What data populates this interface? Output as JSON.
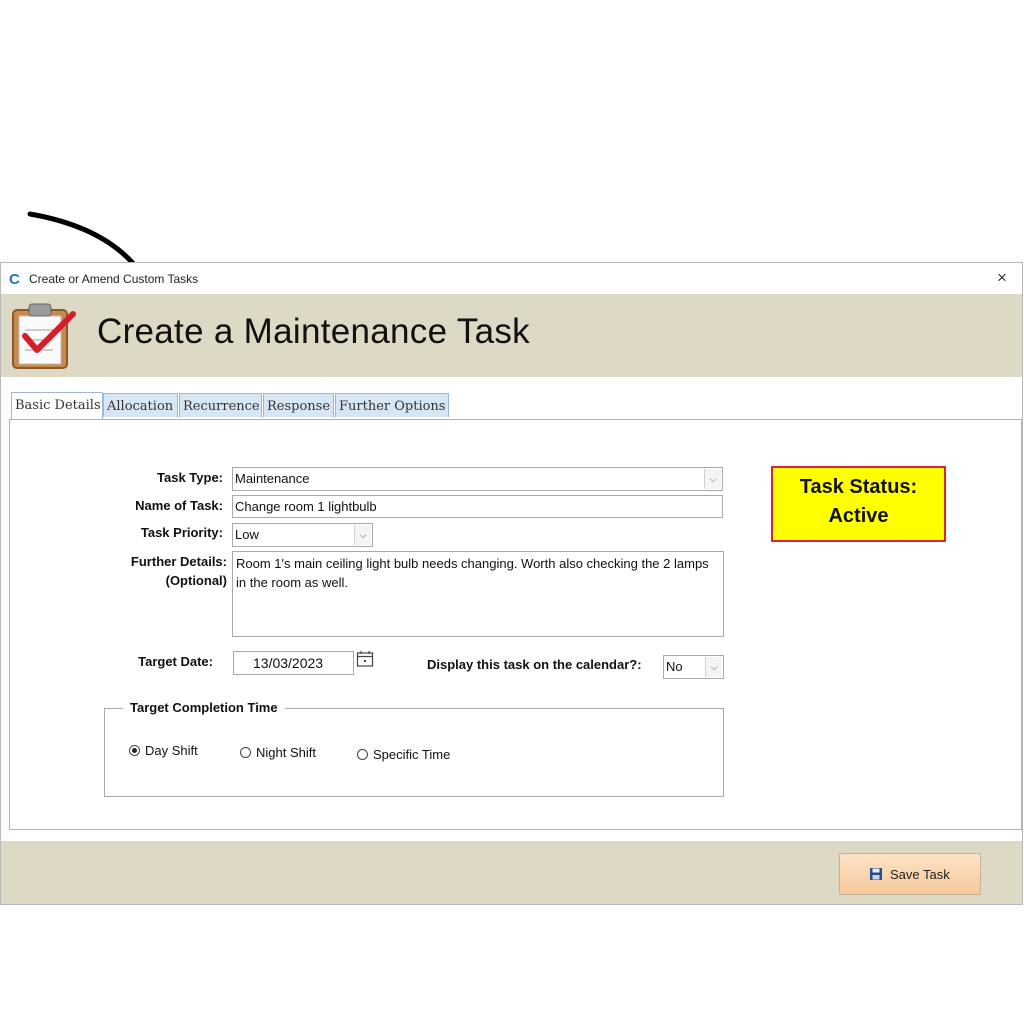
{
  "window": {
    "title": "Create or Amend Custom Tasks",
    "close_icon": "×",
    "app_icon": "C"
  },
  "header": {
    "title": "Create a Maintenance Task",
    "icon": "clipboard-checkmark-icon"
  },
  "tabs": [
    {
      "label": "Basic Details",
      "active": true
    },
    {
      "label": "Allocation",
      "active": false
    },
    {
      "label": "Recurrence",
      "active": false
    },
    {
      "label": "Response",
      "active": false
    },
    {
      "label": "Further Options",
      "active": false
    }
  ],
  "form": {
    "task_type_label": "Task Type:",
    "task_type_value": "Maintenance",
    "name_label": "Name of Task:",
    "name_value": "Change room 1 lightbulb",
    "priority_label": "Task Priority:",
    "priority_value": "Low",
    "details_label_1": "Further Details:",
    "details_label_2": "(Optional)",
    "details_value": "Room 1's main ceiling light bulb needs changing. Worth also checking the 2 lamps in the room as well.",
    "target_date_label": "Target Date:",
    "target_date_value": "13/03/2023",
    "calendar_label": "Display this task on the calendar?:",
    "calendar_value": "No"
  },
  "status": {
    "line1": "Task Status:",
    "line2": "Active",
    "bg_color": "#ffff00",
    "border_color": "#d6263b"
  },
  "completion": {
    "title": "Target Completion Time",
    "options": [
      {
        "label": "Day Shift",
        "selected": true
      },
      {
        "label": "Night Shift",
        "selected": false
      },
      {
        "label": "Specific Time",
        "selected": false
      }
    ]
  },
  "footer": {
    "save_label": "Save Task",
    "save_icon": "floppy-disk-icon"
  },
  "colors": {
    "header_bg": "#ddd9c4",
    "tab_bg": "#d7e6f4",
    "save_button": "#f7c99b"
  }
}
